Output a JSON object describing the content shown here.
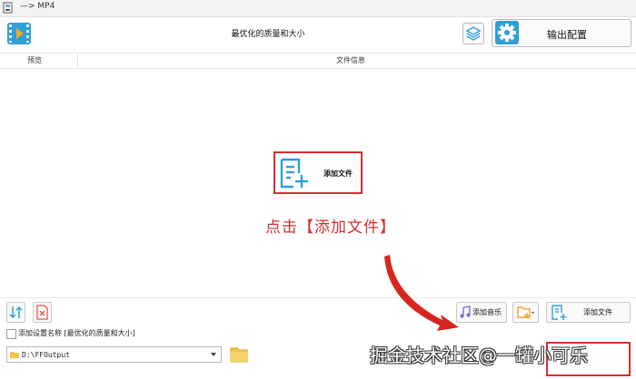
{
  "window": {
    "title": "—> MP4"
  },
  "header": {
    "title": "最优化的质量和大小",
    "output_label": "输出配置"
  },
  "list_header": {
    "preview": "预览",
    "file_info": "文件信息"
  },
  "center": {
    "add_file_label": "添加文件",
    "instruction": "点击【添加文件】"
  },
  "toolbar": {
    "add_music": "添加音乐",
    "add_file": "添加文件"
  },
  "preset": {
    "label": "添加设置名称 [最优化的质量和大小]",
    "checked": false
  },
  "output_path": {
    "value": "D:\\FFOutput"
  },
  "watermark": {
    "text": "掘金技术社区@一罐小可乐"
  },
  "colors": {
    "accent": "#2f9fd8",
    "highlight": "#d32f2f",
    "folder": "#f3c34d"
  }
}
